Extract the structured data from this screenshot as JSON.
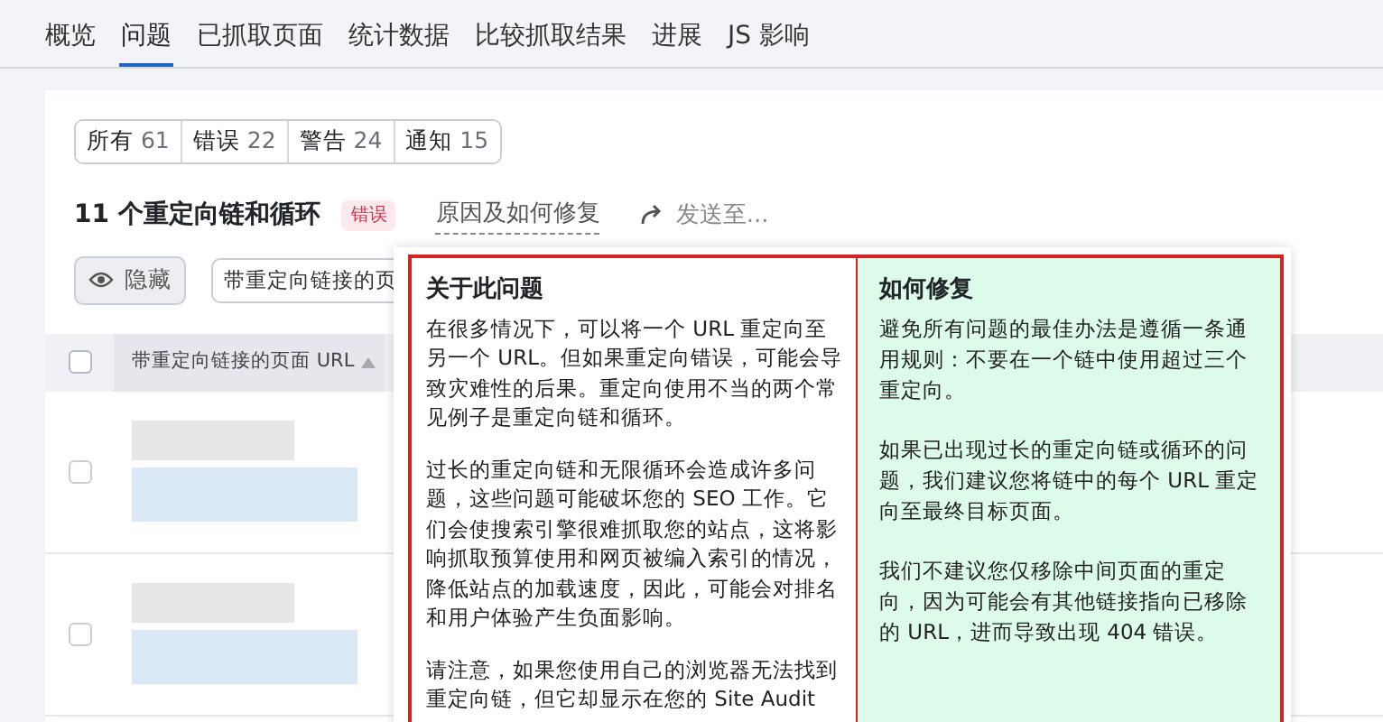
{
  "nav_tabs": [
    {
      "label": "概览",
      "selected": false
    },
    {
      "label": "问题",
      "selected": true
    },
    {
      "label": "已抓取页面",
      "selected": false
    },
    {
      "label": "统计数据",
      "selected": false
    },
    {
      "label": "比较抓取结果",
      "selected": false
    },
    {
      "label": "进展",
      "selected": false
    },
    {
      "label": "JS 影响",
      "selected": false
    }
  ],
  "filters": [
    {
      "label": "所有",
      "count": "61",
      "selected": false
    },
    {
      "label": "错误",
      "count": "22",
      "selected": false
    },
    {
      "label": "警告",
      "count": "24",
      "selected": false
    },
    {
      "label": "通知",
      "count": "15",
      "selected": false
    }
  ],
  "issue": {
    "title": "11 个重定向链和循环",
    "badge": "错误",
    "why_link": "原因及如何修复",
    "send_link": "发送至..."
  },
  "toolbar": {
    "hide_button": "隐藏",
    "column_select": "带重定向链接的页"
  },
  "table": {
    "header_checked": false,
    "columns": [
      "带重定向链接的页面 URL"
    ],
    "rows": [
      {
        "checked": false
      },
      {
        "checked": false
      }
    ]
  },
  "popover": {
    "about": {
      "title": "关于此问题",
      "paragraphs": [
        "在很多情况下，可以将一个 URL 重定向至另一个 URL。但如果重定向错误，可能会导致灾难性的后果。重定向使用不当的两个常见例子是重定向链和循环。",
        "过长的重定向链和无限循环会造成许多问题，这些问题可能破坏您的 SEO 工作。它们会使搜索引擎很难抓取您的站点，这将影响抓取预算使用和网页被编入索引的情况，降低站点的加载速度，因此，可能会对排名和用户体验产生负面影响。",
        "请注意，如果您使用自己的浏览器无法找到重定向链，但它却显示在您的 Site Audit"
      ]
    },
    "fix": {
      "title": "如何修复",
      "paragraphs": [
        "避免所有问题的最佳办法是遵循一条通用规则：不要在一个链中使用超过三个重定向。",
        "如果已出现过长的重定向链或循环的问题，我们建议您将链中的每个 URL 重定向至最终目标页面。",
        "我们不建议您仅移除中间页面的重定向，因为可能会有其他链接指向已移除的 URL，进而导致出现 404 错误。"
      ]
    }
  }
}
